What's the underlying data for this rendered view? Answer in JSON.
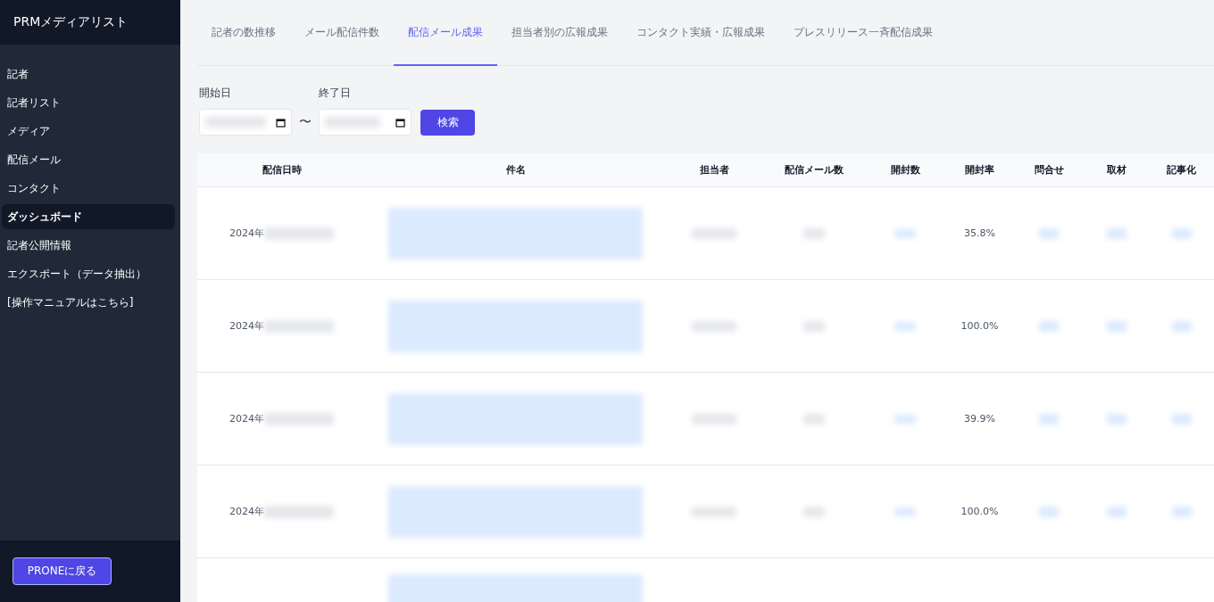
{
  "sidebar": {
    "title": "PRMメディアリスト",
    "items": [
      {
        "label": "記者",
        "selected": false
      },
      {
        "label": "記者リスト",
        "selected": false
      },
      {
        "label": "メディア",
        "selected": false
      },
      {
        "label": "配信メール",
        "selected": false
      },
      {
        "label": "コンタクト",
        "selected": false
      },
      {
        "label": "ダッシュボード",
        "selected": true
      },
      {
        "label": "記者公開情報",
        "selected": false
      },
      {
        "label": "エクスポート（データ抽出）",
        "selected": false
      },
      {
        "label": "[操作マニュアルはこちら]",
        "selected": false
      }
    ],
    "footer_button": "PRONEに戻る"
  },
  "tabs": [
    {
      "label": "記者の数推移",
      "selected": false
    },
    {
      "label": "メール配信件数",
      "selected": false
    },
    {
      "label": "配信メール成果",
      "selected": true
    },
    {
      "label": "担当者別の広報成果",
      "selected": false
    },
    {
      "label": "コンタクト実績・広報成果",
      "selected": false
    },
    {
      "label": "プレスリリース一斉配信成果",
      "selected": false
    }
  ],
  "filters": {
    "start_label": "開始日",
    "separator": "〜",
    "end_label": "終了日",
    "search_button": "検索"
  },
  "table": {
    "columns": [
      "配信日時",
      "件名",
      "担当者",
      "配信メール数",
      "開封数",
      "開封率",
      "問合せ",
      "取材",
      "記事化"
    ],
    "rows": [
      {
        "date": "2024年",
        "open_rate": "35.8%"
      },
      {
        "date": "2024年",
        "open_rate": "100.0%"
      },
      {
        "date": "2024年",
        "open_rate": "39.9%"
      },
      {
        "date": "2024年",
        "open_rate": "100.0%"
      }
    ]
  }
}
